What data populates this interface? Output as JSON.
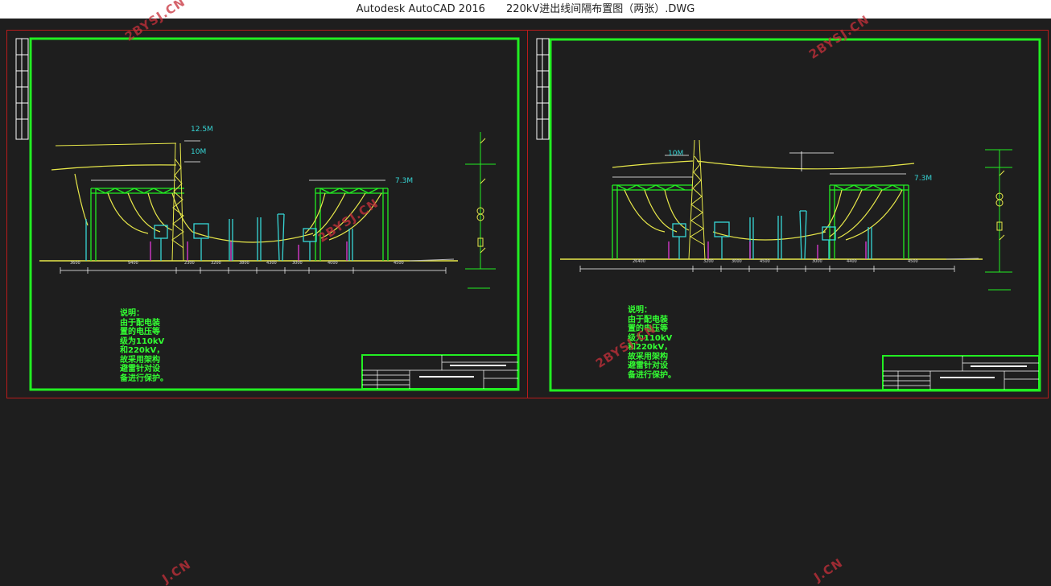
{
  "window": {
    "app_name": "Autodesk AutoCAD 2016",
    "file_name": "220kV进出线间隔布置图（两张）.DWG"
  },
  "watermark": {
    "text": "2BYSJ.CN",
    "partial_text": "J.CN"
  },
  "drawing_left": {
    "height_label_1": "12.5M",
    "height_label_2": "10M",
    "height_label_3": "7.3M",
    "note": "说明：\n由于配电装\n置的电压等\n级为110kV\n和220kV，\n故采用架构\n避雷针对设\n备进行保护。",
    "dimensions": [
      "3600",
      "9400",
      "2300",
      "3200",
      "3800",
      "4300",
      "3000",
      "4000",
      "4500"
    ]
  },
  "drawing_right": {
    "height_label_1": "10M",
    "height_label_2": "7.3M",
    "note": "说明：\n由于配电装\n置的电压等\n级为110kV\n和220kV，\n故采用架构\n避雷针对设\n备进行保护。",
    "dimensions": [
      "26400",
      "3200",
      "3000",
      "4500",
      "3000",
      "4400",
      "4500"
    ]
  },
  "colors": {
    "frame": "#22ee22",
    "sheet_border": "#b81b1b",
    "conductor": "#e8e84a",
    "equipment": "#36d6d6",
    "support": "#e23bd8",
    "background": "#1e1e1e"
  }
}
